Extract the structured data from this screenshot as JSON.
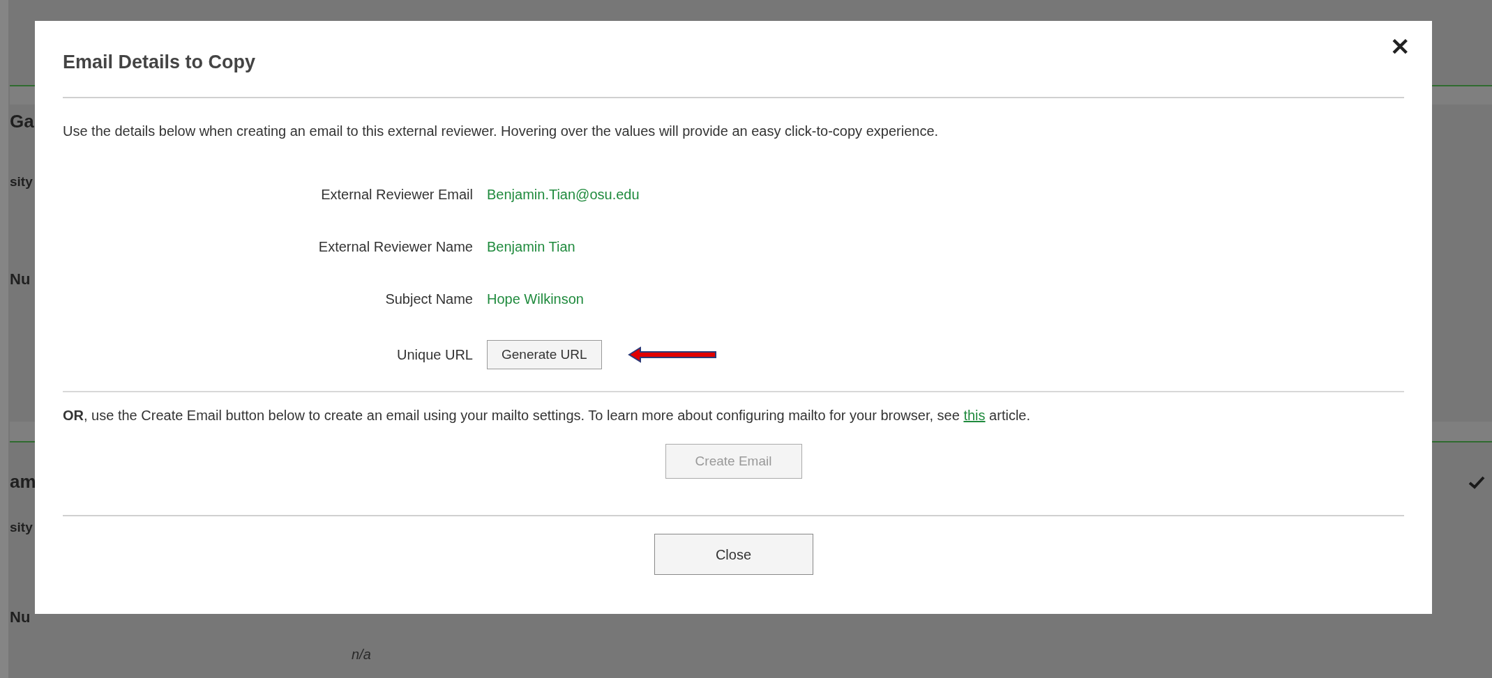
{
  "background": {
    "sections": [
      {
        "heading": "Ga",
        "label": "sity",
        "field": "Nu",
        "checked": false
      },
      {
        "heading": "am",
        "label": "sity",
        "field": "Nu",
        "value": "n/a",
        "checked": true
      }
    ]
  },
  "dialog": {
    "title": "Email Details to Copy",
    "close": "✕",
    "intro": "Use the details below when creating an email to this external reviewer. Hovering over the values will provide an easy click-to-copy experience.",
    "fields": [
      {
        "label": "External Reviewer Email",
        "kind": "value",
        "value": "Benjamin.Tian@osu.edu"
      },
      {
        "label": "External Reviewer Name",
        "kind": "value",
        "value": "Benjamin Tian"
      },
      {
        "label": "Subject Name",
        "kind": "value",
        "value": "Hope Wilkinson"
      },
      {
        "label": "Unique URL",
        "kind": "button",
        "value": "Generate URL",
        "annotated": true
      }
    ],
    "or_text_before": "**OR**, use the Create Email button below to create an email using your mailto settings. To learn more about configuring mailto for your browser, see",
    "or_link": "this",
    "or_text_after": "article.",
    "create_email_button": {
      "label": "Create Email",
      "disabled": true
    },
    "close_button": "Close"
  }
}
